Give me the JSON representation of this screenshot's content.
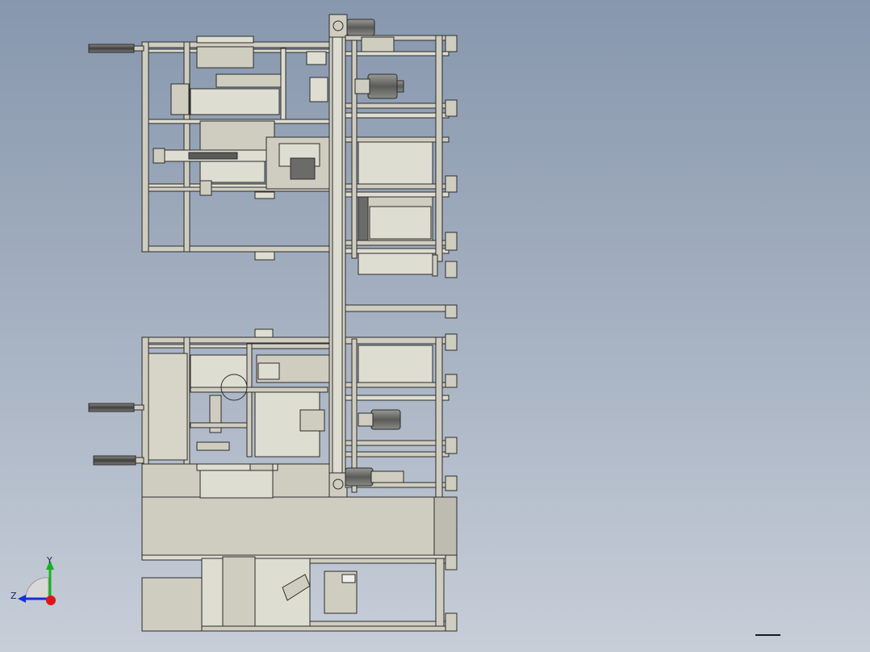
{
  "window": {
    "title": ""
  },
  "model": {
    "name": ""
  },
  "triad": {
    "x_label": "",
    "y_label": "Y",
    "z_label": "Z",
    "colors": {
      "x": "#e01515",
      "y": "#19b020",
      "z": "#1530d8"
    }
  },
  "colors": {
    "background_top": "#8797ad",
    "background_bottom": "#c7ced8",
    "part_fill": "#cfcdc0",
    "part_fill_light": "#deddd1",
    "outline": "#2c2c2c",
    "shadow": "#8e8c84"
  }
}
